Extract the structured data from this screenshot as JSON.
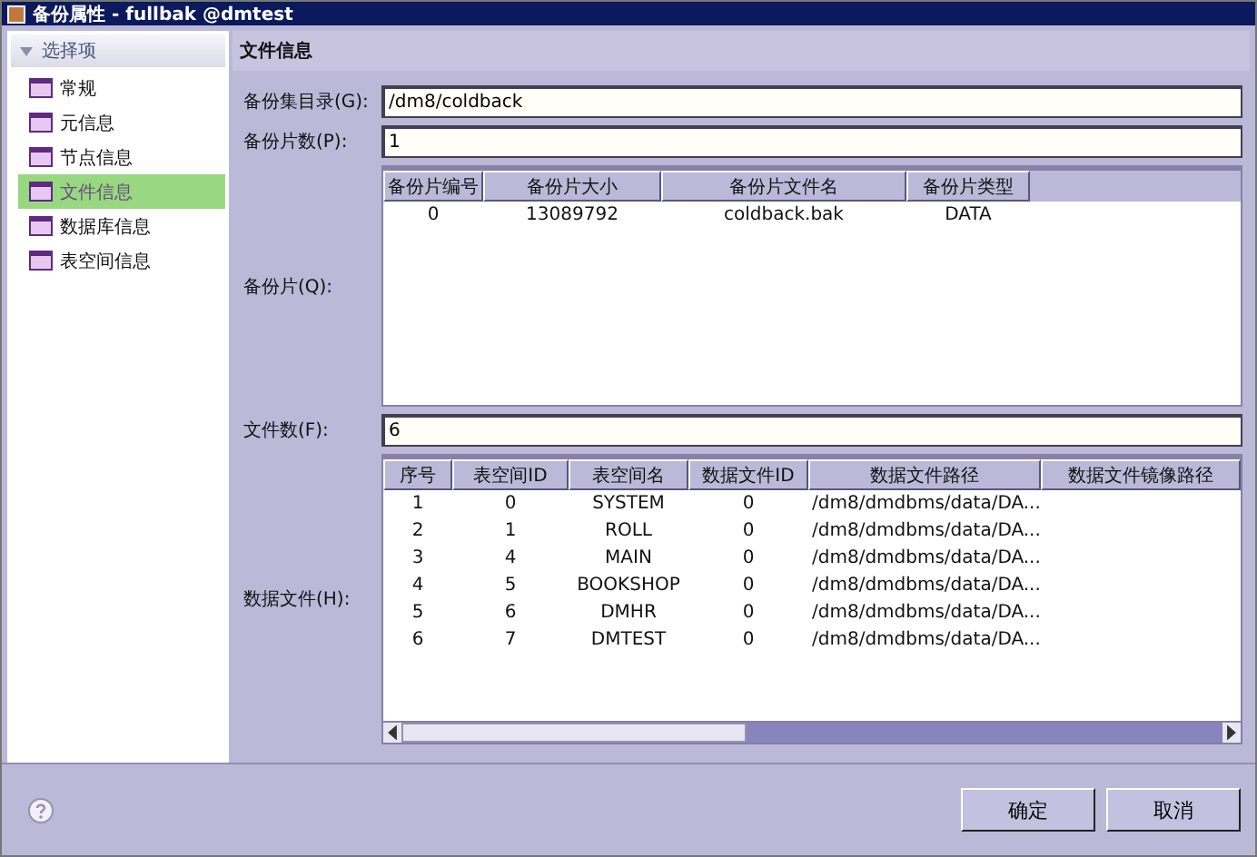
{
  "window": {
    "title": "备份属性 - fullbak @dmtest"
  },
  "sidebar": {
    "header": "选择项",
    "items": [
      {
        "label": "常规",
        "selected": false
      },
      {
        "label": "元信息",
        "selected": false
      },
      {
        "label": "节点信息",
        "selected": false
      },
      {
        "label": "文件信息",
        "selected": true
      },
      {
        "label": "数据库信息",
        "selected": false
      },
      {
        "label": "表空间信息",
        "selected": false
      }
    ]
  },
  "panel": {
    "title": "文件信息"
  },
  "backup_set_dir": {
    "label": "备份集目录(G):",
    "value": "/dm8/coldback"
  },
  "piece_count": {
    "label": "备份片数(P):",
    "value": "1"
  },
  "pieces": {
    "label": "备份片(Q):",
    "columns": [
      "备份片编号",
      "备份片大小",
      "备份片文件名",
      "备份片类型"
    ],
    "rows": [
      [
        "0",
        "13089792",
        "coldback.bak",
        "DATA"
      ]
    ]
  },
  "file_count": {
    "label": "文件数(F):",
    "value": "6"
  },
  "data_files": {
    "label": "数据文件(H):",
    "columns": [
      "序号",
      "表空间ID",
      "表空间名",
      "数据文件ID",
      "数据文件路径",
      "数据文件镜像路径"
    ],
    "rows": [
      [
        "1",
        "0",
        "SYSTEM",
        "0",
        "/dm8/dmdbms/data/DA..."
      ],
      [
        "2",
        "1",
        "ROLL",
        "0",
        "/dm8/dmdbms/data/DA..."
      ],
      [
        "3",
        "4",
        "MAIN",
        "0",
        "/dm8/dmdbms/data/DA..."
      ],
      [
        "4",
        "5",
        "BOOKSHOP",
        "0",
        "/dm8/dmdbms/data/DA..."
      ],
      [
        "5",
        "6",
        "DMHR",
        "0",
        "/dm8/dmdbms/data/DA..."
      ],
      [
        "6",
        "7",
        "DMTEST",
        "0",
        "/dm8/dmdbms/data/DA..."
      ]
    ]
  },
  "buttons": [
    "确定",
    "取消"
  ]
}
